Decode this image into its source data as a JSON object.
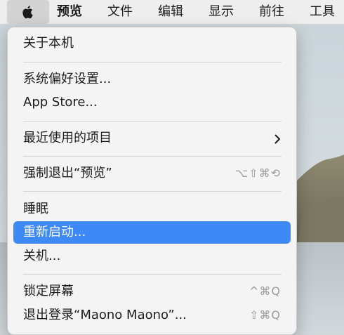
{
  "menubar": {
    "items": [
      "预览",
      "文件",
      "编辑",
      "显示",
      "前往",
      "工具"
    ]
  },
  "menu": {
    "about": "关于本机",
    "system_prefs": "系统偏好设置...",
    "app_store": "App Store...",
    "recent_items": "最近使用的项目",
    "force_quit": "强制退出“预览”",
    "force_quit_shortcut": "⌥⇧⌘⟲",
    "sleep": "睡眠",
    "restart": "重新启动...",
    "shutdown": "关机...",
    "lock_screen": "锁定屏幕",
    "lock_screen_shortcut": "^⌘Q",
    "log_out": "退出登录“Maono Maono”...",
    "log_out_shortcut": "⇧⌘Q"
  },
  "colors": {
    "highlight": "#3d8af7",
    "menu_bg": "#f4f4f4",
    "menubar_bg": "#eeeeee"
  },
  "icons": {
    "apple": "apple-logo-icon",
    "submenu": "chevron-right-icon"
  }
}
